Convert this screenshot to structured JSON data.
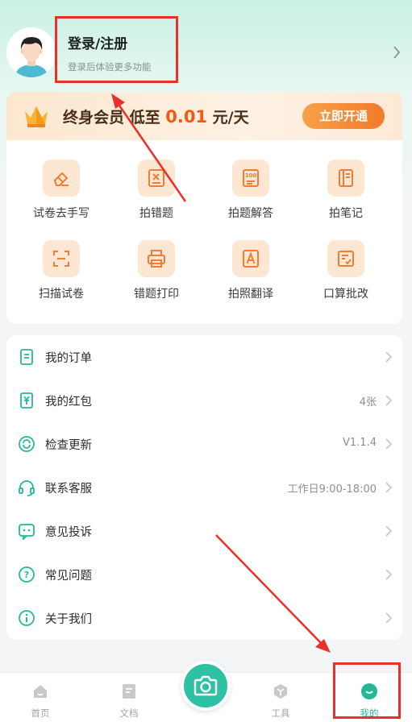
{
  "profile": {
    "title": "登录/注册",
    "subtitle": "登录后体验更多功能"
  },
  "vip": {
    "text_prefix": "终身会员  低至 ",
    "price": "0.01",
    "text_suffix": " 元/天",
    "button_label": "立即开通",
    "accent_color": "#f25a14"
  },
  "tools": [
    {
      "label": "试卷去手写",
      "icon": "eraser-icon"
    },
    {
      "label": "拍错题",
      "icon": "wrong-question-icon"
    },
    {
      "label": "拍题解答",
      "icon": "solve-question-icon"
    },
    {
      "label": "拍笔记",
      "icon": "notebook-icon"
    },
    {
      "label": "扫描试卷",
      "icon": "scan-icon"
    },
    {
      "label": "错题打印",
      "icon": "printer-icon"
    },
    {
      "label": "拍照翻译",
      "icon": "translate-icon"
    },
    {
      "label": "口算批改",
      "icon": "grading-icon"
    }
  ],
  "menu": [
    {
      "label": "我的订单",
      "value": "",
      "icon": "order-icon"
    },
    {
      "label": "我的红包",
      "value": "4张",
      "icon": "red-packet-icon"
    },
    {
      "label": "检查更新",
      "value": "V1.1.4",
      "icon": "refresh-icon"
    },
    {
      "label": "联系客服",
      "value": "工作日9:00-18:00",
      "icon": "headset-icon"
    },
    {
      "label": "意见投诉",
      "value": "",
      "icon": "feedback-icon"
    },
    {
      "label": "常见问题",
      "value": "",
      "icon": "question-icon"
    },
    {
      "label": "关于我们",
      "value": "",
      "icon": "info-icon"
    }
  ],
  "nav": {
    "home": "首页",
    "docs": "文档",
    "tools": "工具",
    "mine": "我的",
    "camera_icon": "camera-icon",
    "active": "mine",
    "active_color": "#24b89a"
  },
  "annotations": {
    "highlight_color": "#e8312a"
  }
}
